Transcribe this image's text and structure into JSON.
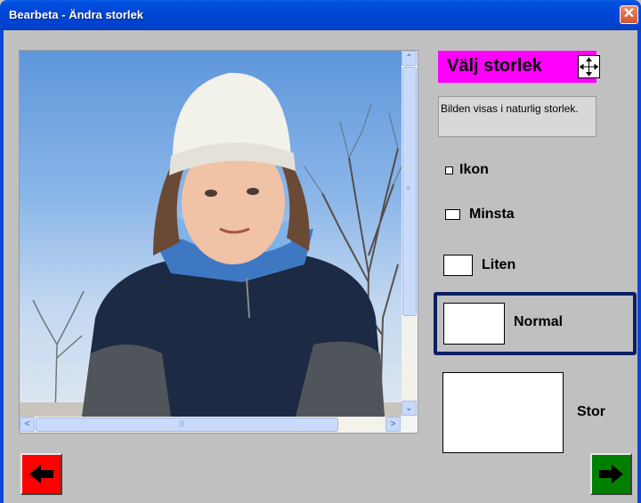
{
  "window": {
    "title": "Bearbeta - Ändra storlek",
    "close_glyph": "✕"
  },
  "scroll": {
    "up_glyph": "⌃",
    "down_glyph": "⌄",
    "left_glyph": "<",
    "right_glyph": ">",
    "grip_glyph": "≡",
    "hgrip_glyph": "|||"
  },
  "panel": {
    "heading": "Välj storlek",
    "heading_bg": "#ff00ff",
    "info_text": "Bilden visas i naturlig storlek.",
    "options": [
      {
        "label": "Ikon"
      },
      {
        "label": "Minsta"
      },
      {
        "label": "Liten"
      },
      {
        "label": "Normal",
        "selected": true
      },
      {
        "label": "Stor"
      }
    ]
  },
  "nav": {
    "back_color": "#ff0000",
    "forward_color": "#008000",
    "back_icon": "left-arrow-icon",
    "forward_icon": "right-arrow-icon"
  }
}
